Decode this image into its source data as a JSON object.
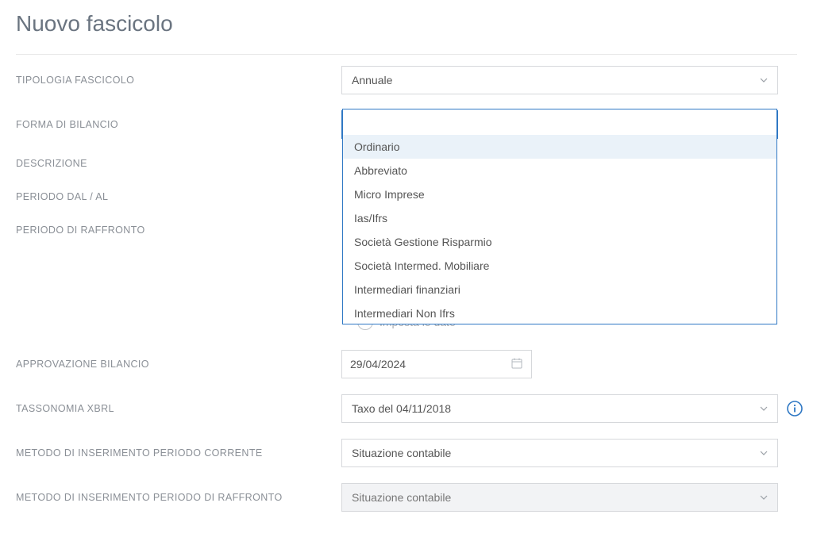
{
  "page_title": "Nuovo fascicolo",
  "labels": {
    "tipologia_fascicolo": "TIPOLOGIA FASCICOLO",
    "forma_di_bilancio": "FORMA DI BILANCIO",
    "descrizione": "DESCRIZIONE",
    "periodo_dal_al": "PERIODO DAL / AL",
    "periodo_di_raffronto": "PERIODO DI RAFFRONTO",
    "approvazione_bilancio": "APPROVAZIONE BILANCIO",
    "tassonomia_xbrl": "TASSONOMIA XBRL",
    "metodo_inserimento_corrente": "METODO DI INSERIMENTO PERIODO CORRENTE",
    "metodo_inserimento_raffronto": "METODO DI INSERIMENTO PERIODO DI RAFFRONTO"
  },
  "values": {
    "tipologia_fascicolo": "Annuale",
    "approvazione_bilancio": "29/04/2024",
    "tassonomia_xbrl": "Taxo del 04/11/2018",
    "metodo_inserimento_corrente": "Situazione contabile",
    "metodo_inserimento_raffronto": "Situazione contabile"
  },
  "toggle_text": "Imposta le date",
  "dropdown_items": [
    "Ordinario",
    "Abbreviato",
    "Micro Imprese",
    "Ias/Ifrs",
    "Società Gestione Risparmio",
    "Società Intermed. Mobiliare",
    "Intermediari finanziari",
    "Intermediari Non Ifrs"
  ]
}
